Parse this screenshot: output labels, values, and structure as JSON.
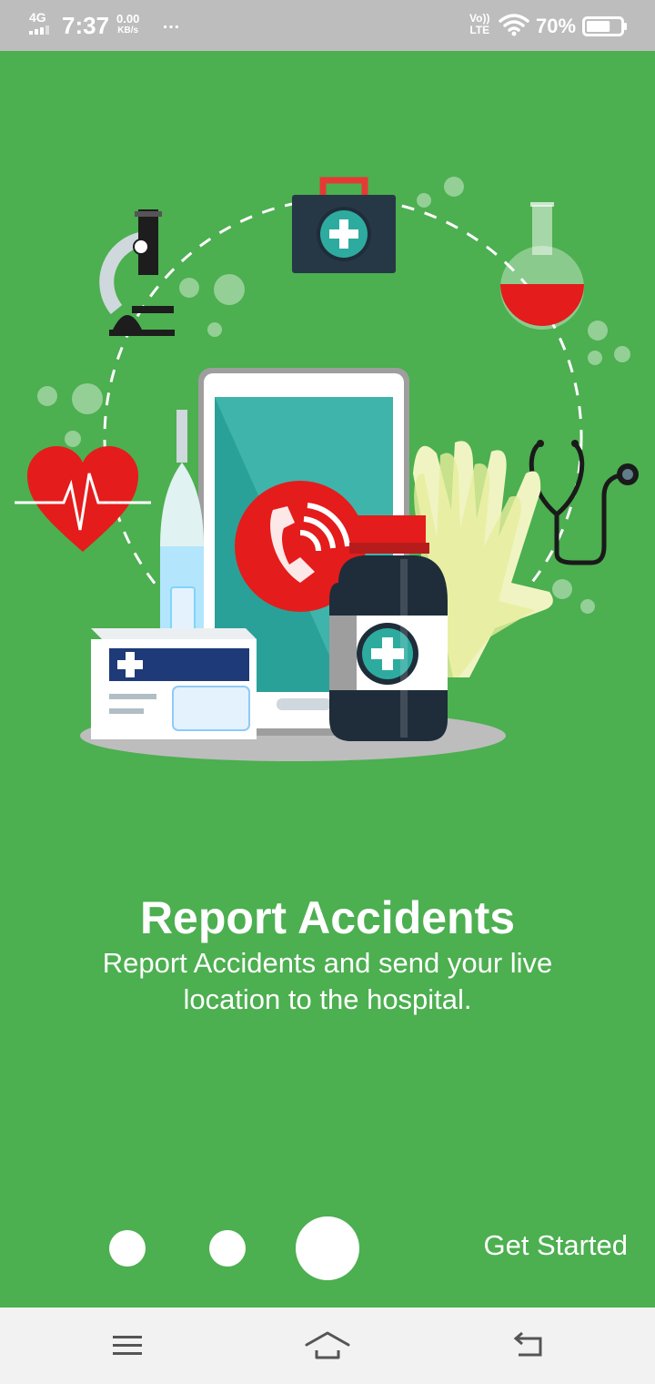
{
  "status_bar": {
    "network": "4G",
    "time": "7:37",
    "speed_value": "0.00",
    "speed_unit": "KB/s",
    "more": "…",
    "volte_top": "Vo))",
    "volte_bottom": "LTE",
    "battery_percent": "70%",
    "battery_level": 0.7
  },
  "onboarding": {
    "title": "Report Accidents",
    "description": "Report Accidents and send your live location to the hospital.",
    "page_count": 3,
    "active_page": 3,
    "get_started_label": "Get Started"
  },
  "nav_bar": {
    "icons": [
      "menu-icon",
      "home-icon",
      "back-icon"
    ]
  },
  "colors": {
    "background": "#4caf50",
    "status_bar": "#bdbdbd",
    "nav_bar": "#f2f2f2",
    "accent_red": "#e52222",
    "teal": "#2e9e96",
    "dark_navy": "#1f2d3a"
  }
}
